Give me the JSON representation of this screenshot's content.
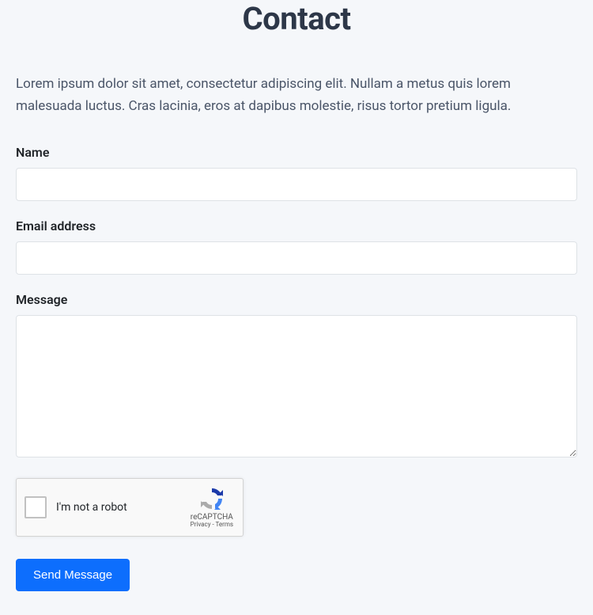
{
  "page": {
    "title": "Contact",
    "intro": "Lorem ipsum dolor sit amet, consectetur adipiscing elit. Nullam a metus quis lorem malesuada luctus. Cras lacinia, eros at dapibus molestie, risus tortor pretium ligula."
  },
  "form": {
    "name": {
      "label": "Name",
      "value": ""
    },
    "email": {
      "label": "Email address",
      "value": ""
    },
    "message": {
      "label": "Message",
      "value": ""
    },
    "recaptcha": {
      "label": "I'm not a robot",
      "brand": "reCAPTCHA",
      "links": "Privacy - Terms"
    },
    "submit": {
      "label": "Send Message"
    }
  }
}
